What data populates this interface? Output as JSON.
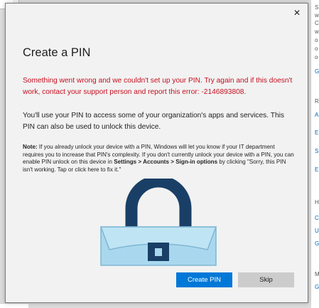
{
  "dialog": {
    "close_label": "✕",
    "title": "Create a PIN",
    "error_message": "Something went wrong and we couldn't set up your PIN. Try again and if this doesn't work, contact your support person and report this error: -2146893808.",
    "description": "You'll use your PIN to access some of your organization's apps and services. This PIN can also be used to unlock this device.",
    "note": {
      "label": "Note:",
      "text_1": " If you already unlock your device with a PIN, Windows will let you know if your IT department requires you to increase that PIN's complexity. If you don't currently unlock your device with a PIN, you can enable PIN unlock on this device in ",
      "path_1": "Settings",
      "sep_1": " > ",
      "path_2": "Accounts",
      "sep_2": " > ",
      "path_3": "Sign-in options",
      "text_2": " by clicking \"Sorry, this PIN isn't working. Tap or click here to fix it.\""
    },
    "illustration_icon": "padlock-icon",
    "buttons": {
      "primary_label": "Create PIN",
      "secondary_label": "Skip"
    }
  },
  "background_window": {
    "right_edge_letters": [
      "S",
      "w",
      "C",
      "w",
      "o",
      "o",
      "o",
      "G",
      "R",
      "A",
      "E",
      "S",
      "E",
      "H",
      "C",
      "U",
      "G",
      "M",
      "G"
    ]
  },
  "colors": {
    "accent": "#0078d7",
    "error": "#c50f1f",
    "lock_shackle": "#1a3f66",
    "lock_body": "#a9d8ee"
  }
}
